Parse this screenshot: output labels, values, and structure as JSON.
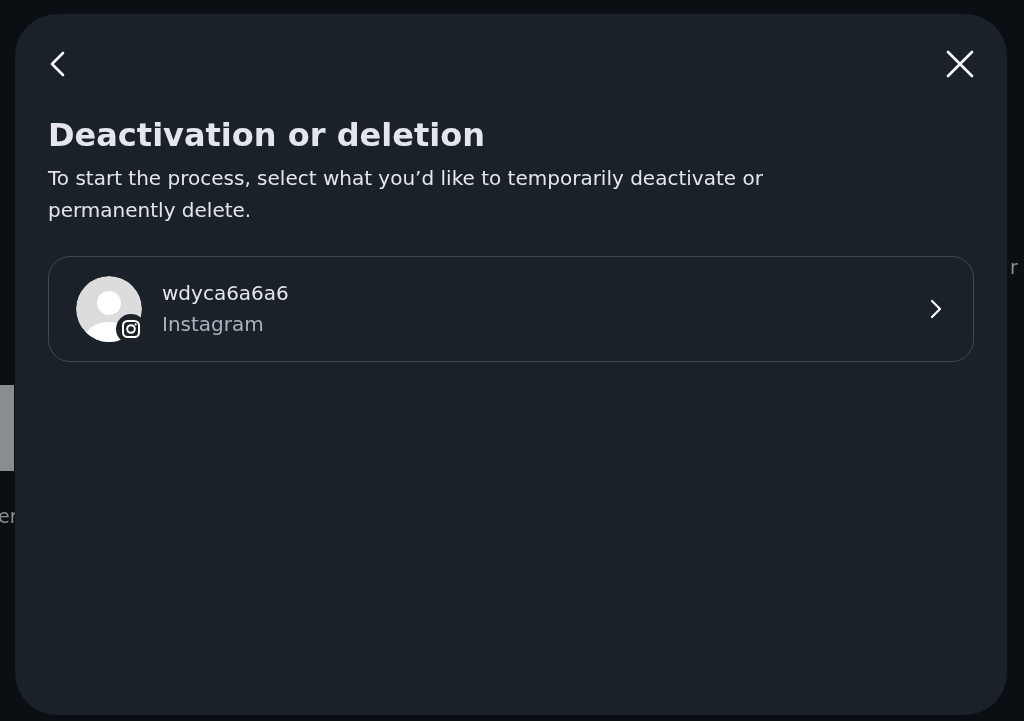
{
  "background": {
    "fragments": [
      "er",
      "r"
    ]
  },
  "dialog": {
    "title": "Deactivation or deletion",
    "description": "To start the process, select what you’d like to temporarily deactivate or permanently delete.",
    "accounts": [
      {
        "username": "wdyca6a6a6",
        "platform": "Instagram"
      }
    ]
  }
}
